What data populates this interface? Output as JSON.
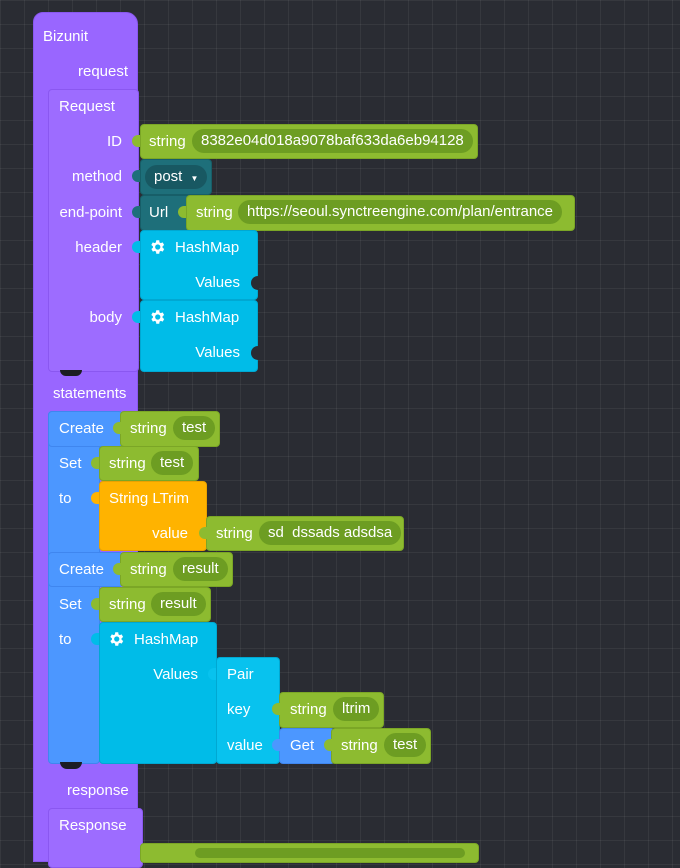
{
  "bizunit": {
    "title": "Bizunit",
    "request_label": "request",
    "statements_label": "statements",
    "response_label": "response"
  },
  "request": {
    "title": "Request",
    "id_label": "ID",
    "method_label": "method",
    "endpoint_label": "end-point",
    "header_label": "header",
    "body_label": "body"
  },
  "id_block": {
    "type": "string",
    "value": "8382e04d018a9078baf633da6eb94128"
  },
  "method_block": {
    "value": "post"
  },
  "url_block": {
    "label": "Url",
    "type": "string",
    "value": "https://seoul.synctreengine.com/plan/entrance"
  },
  "header_hashmap": {
    "label": "HashMap",
    "values_label": "Values"
  },
  "body_hashmap": {
    "label": "HashMap",
    "values_label": "Values"
  },
  "statements": {
    "create1": {
      "label": "Create",
      "type": "string",
      "value": "test"
    },
    "set1": {
      "set_label": "Set",
      "to_label": "to",
      "type": "string",
      "value": "test",
      "ltrim": {
        "label": "String LTrim",
        "value_label": "value",
        "type": "string",
        "value": "sd  dssads adsdsa"
      }
    },
    "create2": {
      "label": "Create",
      "type": "string",
      "value": "result"
    },
    "set2": {
      "set_label": "Set",
      "to_label": "to",
      "type": "string",
      "value": "result",
      "hashmap": {
        "label": "HashMap",
        "values_label": "Values",
        "pair": {
          "label": "Pair",
          "key_label": "key",
          "value_label": "value",
          "key_type": "string",
          "key_value": "ltrim",
          "get_label": "Get",
          "get_type": "string",
          "get_value": "test"
        }
      }
    }
  },
  "response": {
    "title": "Response"
  },
  "colors": {
    "background": "#2a2c33",
    "bizunit": "#9966ff",
    "statement": "#4c97ff",
    "hashmap": "#00bce8",
    "string": "#8dbb30",
    "method": "#1e6f7a",
    "ltrim": "#ffb300"
  }
}
